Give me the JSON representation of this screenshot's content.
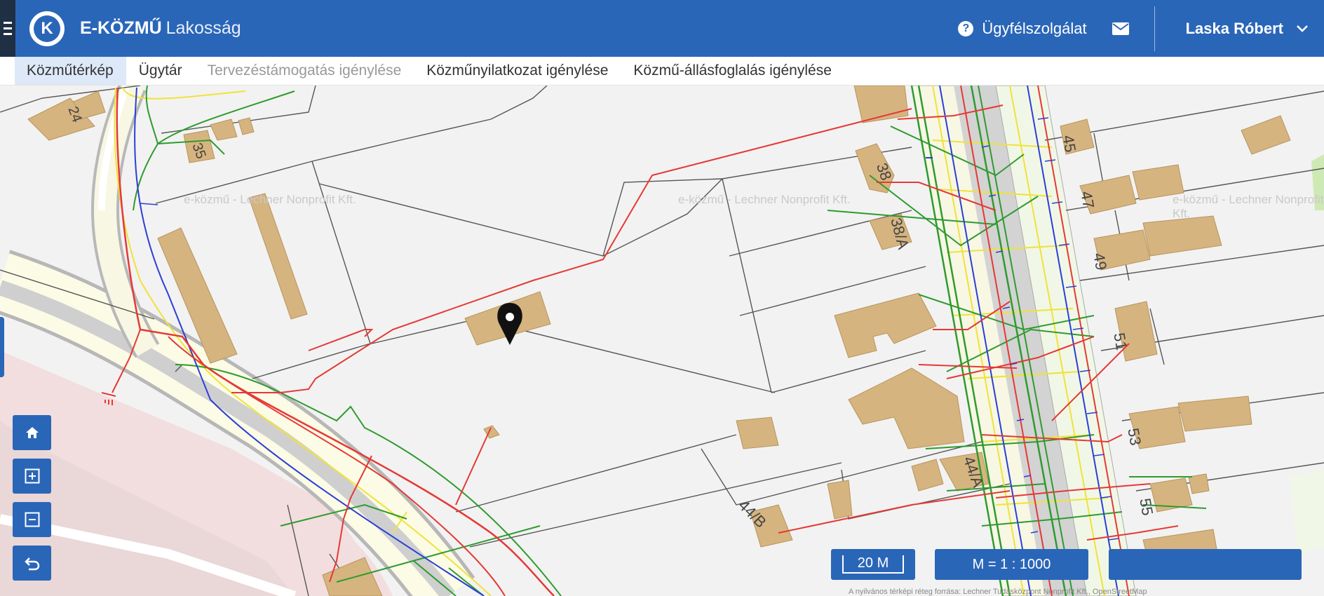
{
  "app": {
    "brand": "E-KÖZMŰ",
    "brand_sub": "Lakosság",
    "logo_letter": "K"
  },
  "header": {
    "help_label": "Ügyfélszolgálat",
    "user_name": "Laska Róbert"
  },
  "nav": {
    "items": [
      {
        "label": "Közműtérkép"
      },
      {
        "label": "Ügytár"
      },
      {
        "label": "Tervezéstámogatás igénylése"
      },
      {
        "label": "Közműnyilatkozat igénylése"
      },
      {
        "label": "Közmű-állásfoglalás igénylése"
      }
    ]
  },
  "map": {
    "watermark": "e-közmű - Lechner Nonprofit Kft.",
    "house_numbers": [
      "24",
      "35",
      "38",
      "38/A",
      "45",
      "47",
      "49",
      "51",
      "53",
      "55",
      "44/A",
      "44/B"
    ],
    "scale_bar": "20 M",
    "scale_ratio": "M = 1 : 1000",
    "attribution": "A nyilvános térképi réteg forrása: Lechner Tudásközpont Nonprofit Kft., OpenStreetMap"
  },
  "colors": {
    "header_bg": "#2a66b8",
    "pipe_red": "#e53935",
    "pipe_green": "#2e9b2e",
    "pipe_blue": "#2b3fd6",
    "pipe_yellow": "#f0e23a",
    "building": "#d6b47f"
  }
}
